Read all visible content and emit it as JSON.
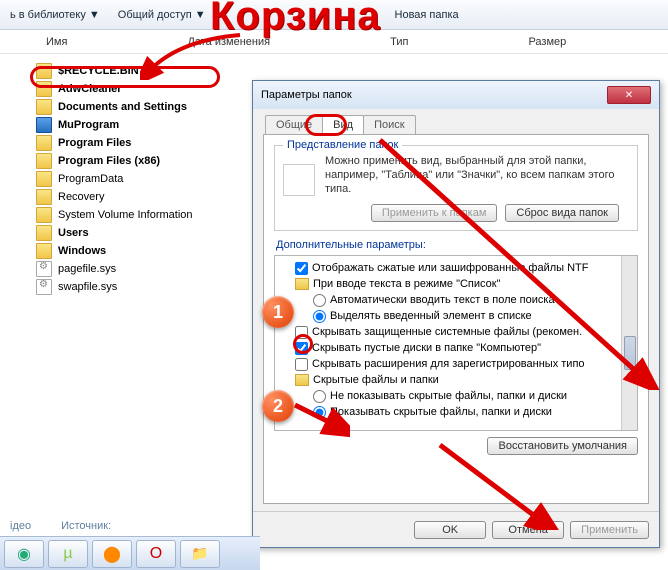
{
  "toolbar": {
    "library": "ь в библиотеку ▼",
    "share": "Общий доступ ▼",
    "newfolder": "Новая папка"
  },
  "columns": {
    "name": "Имя",
    "date": "Дата изменения",
    "type": "Тип",
    "size": "Размер"
  },
  "files": [
    {
      "name": "$RECYCLE.BIN",
      "type": "folder",
      "bold": true
    },
    {
      "name": "AdwCleaner",
      "type": "folder",
      "bold": true
    },
    {
      "name": "Documents and Settings",
      "type": "folder",
      "bold": true
    },
    {
      "name": "MuProgram",
      "type": "folder-blue",
      "bold": true
    },
    {
      "name": "Program Files",
      "type": "folder",
      "bold": true
    },
    {
      "name": "Program Files (x86)",
      "type": "folder",
      "bold": true
    },
    {
      "name": "ProgramData",
      "type": "folder",
      "bold": false
    },
    {
      "name": "Recovery",
      "type": "folder",
      "bold": false
    },
    {
      "name": "System Volume Information",
      "type": "folder",
      "bold": false
    },
    {
      "name": "Users",
      "type": "folder",
      "bold": true
    },
    {
      "name": "Windows",
      "type": "folder",
      "bold": true
    },
    {
      "name": "pagefile.sys",
      "type": "sysfile",
      "bold": false
    },
    {
      "name": "swapfile.sys",
      "type": "sysfile",
      "bold": false
    }
  ],
  "annotation": {
    "title": "Корзина",
    "badge1": "1",
    "badge2": "2"
  },
  "dialog": {
    "title": "Параметры папок",
    "tabs": {
      "general": "Общие",
      "view": "Вид",
      "search": "Поиск"
    },
    "group": {
      "title": "Представление папок",
      "text": "Можно применить вид, выбранный для этой папки, например, \"Таблица\" или \"Значки\", ко всем папкам этого типа.",
      "apply": "Применить к папкам",
      "reset": "Сброс вида папок"
    },
    "advlabel": "Дополнительные параметры:",
    "tree": {
      "r0": "Отображать сжатые или зашифрованные файлы NTF",
      "r1": "При вводе текста в режиме \"Список\"",
      "r1a": "Автоматически вводить текст в поле поиска",
      "r1b": "Выделять введенный элемент в списке",
      "r2": "Скрывать защищенные системные файлы (рекомен.",
      "r3": "Скрывать пустые диски в папке \"Компьютер\"",
      "r4": "Скрывать расширения для зарегистрированных типо",
      "r5": "Скрытые файлы и папки",
      "r5a": "Не показывать скрытые файлы, папки и диски",
      "r5b": "Показывать скрытые файлы, папки и диски"
    },
    "restore": "Восстановить умолчания",
    "ok": "OK",
    "cancel": "Отмена",
    "apply": "Применить"
  },
  "bottom": {
    "video": "ідео",
    "source": "Источник:"
  }
}
